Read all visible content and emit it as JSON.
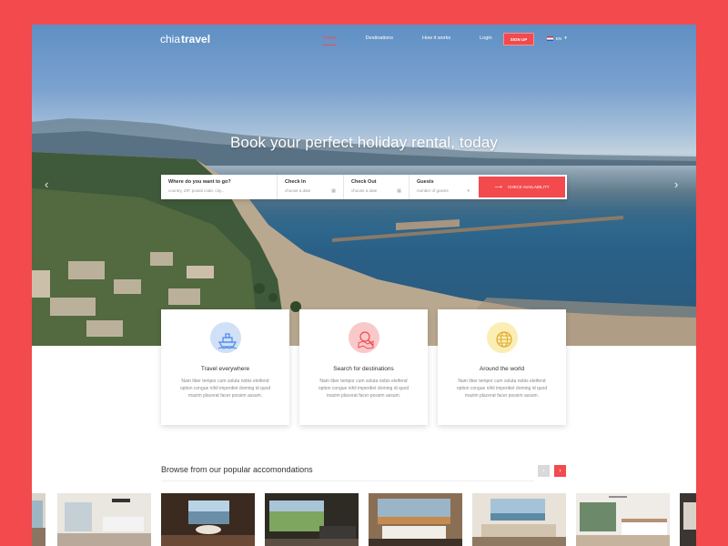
{
  "brand": {
    "light": "chia",
    "bold": "travel"
  },
  "nav": {
    "items": [
      {
        "label": "Home",
        "active": true
      },
      {
        "label": "Destinations",
        "active": false
      },
      {
        "label": "How it works",
        "active": false
      },
      {
        "label": "Login",
        "active": false
      }
    ],
    "signup_label": "SIGN UP",
    "language": "EN"
  },
  "hero": {
    "title": "Book your perfect holiday rental, today"
  },
  "search": {
    "where": {
      "label": "Where do you want to go?",
      "placeholder": "country, ZIP, postal code, city..."
    },
    "checkin": {
      "label": "Check In",
      "placeholder": "choose a date"
    },
    "checkout": {
      "label": "Check Out",
      "placeholder": "choose a date"
    },
    "guests": {
      "label": "Guests",
      "placeholder": "number of guests"
    },
    "button_label": "CHECK AVAILABILITY"
  },
  "features": [
    {
      "title": "Travel everywhere",
      "icon": "ship-icon",
      "color": "#cfe0f7",
      "text": "Nam liber tempor cum soluta nobis eleifend option congue nihil imperdiet doming id quod mazim placerat facer possim assum."
    },
    {
      "title": "Search for destinations",
      "icon": "search-map-icon",
      "color": "#f9c9ca",
      "text": "Nam liber tempor cum soluta nobis eleifend option congue nihil imperdiet doming id quod mazim placerat facer possim assum."
    },
    {
      "title": "Around the world",
      "icon": "globe-icon",
      "color": "#fbeeb5",
      "text": "Nam liber tempor cum soluta nobis eleifend option congue nihil imperdiet doming id quod mazim placerat facer possim assum."
    }
  ],
  "browse": {
    "title": "Browse from our popular accomondations"
  },
  "colors": {
    "accent": "#f24a4d"
  }
}
